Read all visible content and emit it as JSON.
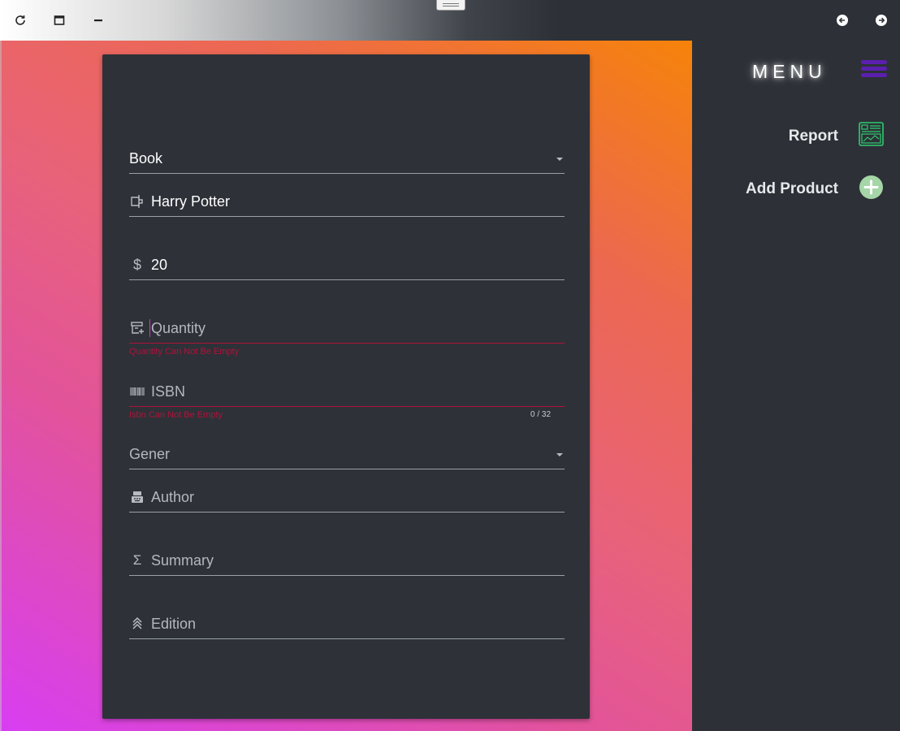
{
  "titlebar": {
    "icons": [
      "refresh-icon",
      "maximize-icon",
      "minimize-icon",
      "back-arrow-icon",
      "forward-arrow-icon"
    ]
  },
  "form": {
    "product_type": {
      "value": "Book"
    },
    "name": {
      "value": "Harry Potter",
      "icon": "tag-icon"
    },
    "price": {
      "value": "20",
      "icon": "dollar-icon"
    },
    "quantity": {
      "placeholder": "Quantity",
      "error": "Quantity Can Not Be Empty",
      "icon": "inventory-icon"
    },
    "isbn": {
      "placeholder": "ISBN",
      "error": "Isbn Can Not Be Empty",
      "counter": "0 / 32",
      "icon": "barcode-icon"
    },
    "genre": {
      "placeholder": "Gener"
    },
    "author": {
      "placeholder": "Author",
      "icon": "typewriter-icon"
    },
    "summary": {
      "placeholder": "Summary",
      "icon": "sigma-icon"
    },
    "edition": {
      "placeholder": "Edition",
      "icon": "chevrons-up-icon"
    }
  },
  "sidebar": {
    "title": "MENU",
    "items": [
      {
        "label": "Report",
        "icon": "report-icon"
      },
      {
        "label": "Add Product",
        "icon": "add-circle-icon"
      }
    ]
  },
  "colors": {
    "error": "#b0123a",
    "card": "#2e3138",
    "sidebar": "#2d3137",
    "report_icon": "#2ecc71",
    "add_icon": "#a5d6a7",
    "menu_icon": "#5b1fb0"
  }
}
